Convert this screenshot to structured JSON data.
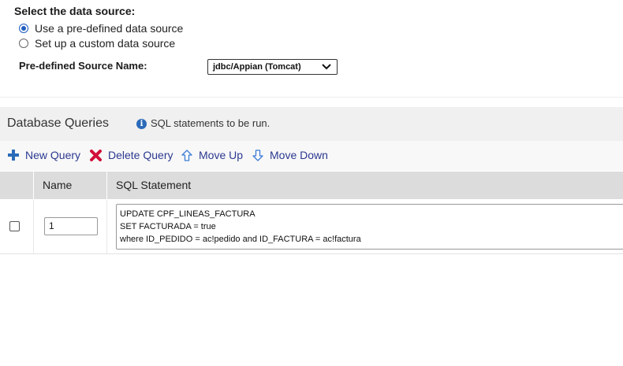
{
  "source": {
    "title": "Select the data source:",
    "options": [
      {
        "label": "Use a pre-defined data source",
        "selected": true
      },
      {
        "label": "Set up a custom data source",
        "selected": false
      }
    ],
    "predefined_label": "Pre-defined Source Name:",
    "predefined_value": "jdbc/Appian (Tomcat)"
  },
  "queries": {
    "title": "Database Queries",
    "info_text": "SQL statements to be run.",
    "toolbar": {
      "new_label": "New Query",
      "delete_label": "Delete Query",
      "move_up_label": "Move Up",
      "move_down_label": "Move Down"
    },
    "columns": {
      "name": "Name",
      "sql": "SQL Statement"
    },
    "rows": [
      {
        "checked": false,
        "name": "1",
        "sql_lines": [
          "UPDATE CPF_LINEAS_FACTURA",
          "SET FACTURADA = true",
          "where ID_PEDIDO = ac!pedido and ID_FACTURA = ac!factura"
        ]
      }
    ]
  },
  "colors": {
    "accent": "#2b3990",
    "radio": "#1f5fbf",
    "delete": "#d0103a",
    "header_bg": "#dcdcdc"
  }
}
